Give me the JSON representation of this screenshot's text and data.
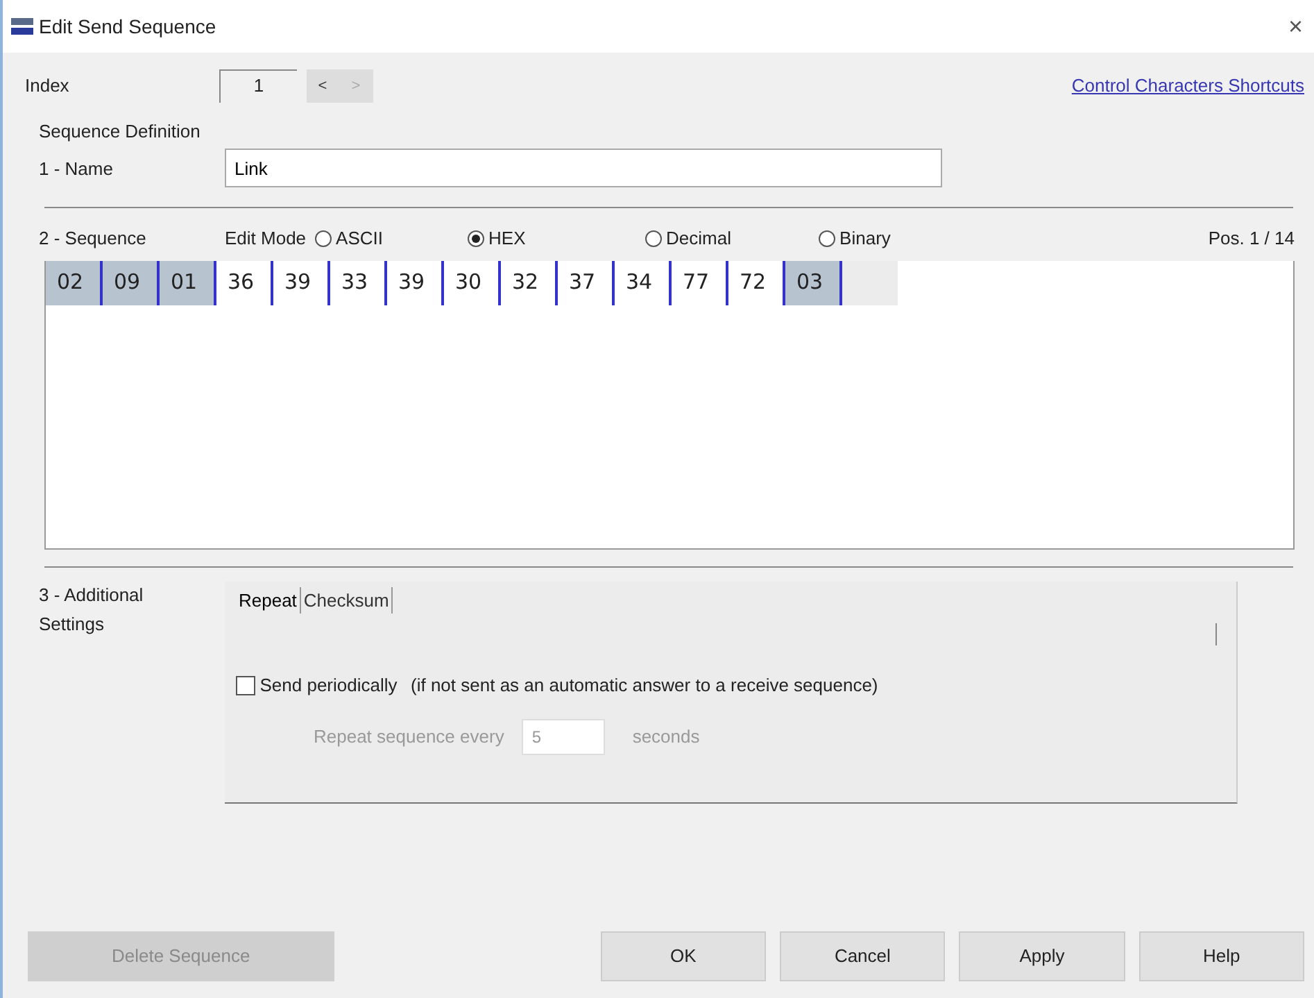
{
  "window": {
    "title": "Edit Send Sequence",
    "close": "×"
  },
  "index": {
    "label": "Index",
    "value": "1",
    "prev": {
      "label": "<",
      "disabled": false
    },
    "next": {
      "label": ">",
      "disabled": true
    }
  },
  "link": "Control Characters Shortcuts",
  "section_title": "Sequence Definition",
  "name_field": {
    "label": "1 - Name",
    "value": "Link"
  },
  "sequence": {
    "label": "2 - Sequence",
    "edit_mode_label": "Edit Mode",
    "position": "Pos. 1 / 14",
    "modes": [
      {
        "label": "ASCII",
        "selected": false
      },
      {
        "label": "HEX",
        "selected": true
      },
      {
        "label": "Decimal",
        "selected": false
      },
      {
        "label": "Binary",
        "selected": false
      }
    ],
    "bytes": [
      {
        "value": "02",
        "control": true
      },
      {
        "value": "09",
        "control": true
      },
      {
        "value": "01",
        "control": true
      },
      {
        "value": "36",
        "control": false
      },
      {
        "value": "39",
        "control": false
      },
      {
        "value": "33",
        "control": false
      },
      {
        "value": "39",
        "control": false
      },
      {
        "value": "30",
        "control": false
      },
      {
        "value": "32",
        "control": false
      },
      {
        "value": "37",
        "control": false
      },
      {
        "value": "34",
        "control": false
      },
      {
        "value": "77",
        "control": false
      },
      {
        "value": "72",
        "control": false
      },
      {
        "value": "03",
        "control": true
      }
    ]
  },
  "additional": {
    "label": "3 - Additional Settings",
    "tabs": [
      {
        "label": "Repeat",
        "selected": true
      },
      {
        "label": "Checksum",
        "selected": false
      }
    ],
    "send_periodically": {
      "label": "Send periodically",
      "note": "(if not sent as an automatic answer to a receive sequence)",
      "checked": false
    },
    "repeat": {
      "label": "Repeat sequence every",
      "value": "5",
      "unit": "seconds",
      "disabled": true
    }
  },
  "buttons": [
    {
      "label": "Delete Sequence",
      "disabled": true
    },
    {
      "label": "OK",
      "disabled": false
    },
    {
      "label": "Cancel",
      "disabled": false
    },
    {
      "label": "Apply",
      "disabled": false
    },
    {
      "label": "Help",
      "disabled": false
    }
  ]
}
